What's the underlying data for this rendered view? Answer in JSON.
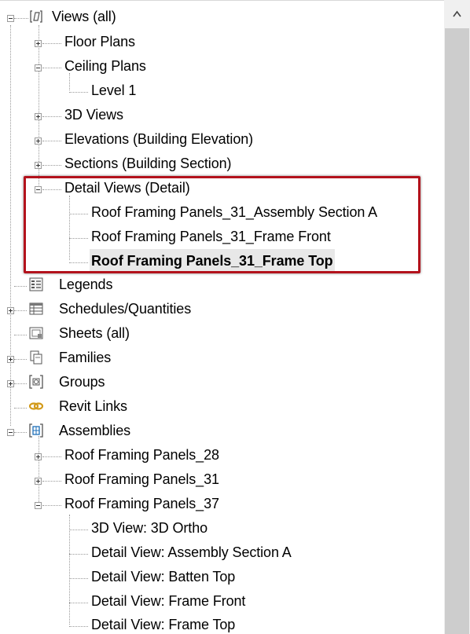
{
  "tree": {
    "views_all": "Views (all)",
    "floor_plans": "Floor Plans",
    "ceiling_plans": "Ceiling Plans",
    "level_1": "Level 1",
    "views_3d": "3D Views",
    "elevations": "Elevations (Building Elevation)",
    "sections": "Sections (Building Section)",
    "detail_views": "Detail Views (Detail)",
    "detail_items": [
      "Roof Framing Panels_31_Assembly Section A",
      "Roof Framing Panels_31_Frame Front",
      "Roof Framing Panels_31_Frame Top"
    ],
    "legends": "Legends",
    "schedules": "Schedules/Quantities",
    "sheets": "Sheets (all)",
    "families": "Families",
    "groups": "Groups",
    "revit_links": "Revit Links",
    "assemblies": "Assemblies",
    "assembly_items": [
      "Roof Framing Panels_28",
      "Roof Framing Panels_31",
      "Roof Framing Panels_37"
    ],
    "assembly_37_children": [
      "3D View: 3D Ortho",
      "Detail View: Assembly Section A",
      "Detail View: Batten Top",
      "Detail View: Frame Front",
      "Detail View: Frame Top"
    ]
  },
  "selected_item": "Roof Framing Panels_31_Frame Top",
  "colors": {
    "highlight_box": "#b3121c",
    "tree_lines": "#9a9a9a",
    "scrollbar_thumb": "#cdcdcd",
    "links_icon": "#d29a1a"
  },
  "icons": {
    "views_root": "views-bracket-icon",
    "legends": "legends-icon",
    "schedules": "schedules-icon",
    "sheets": "sheets-icon",
    "families": "families-icon",
    "groups": "groups-icon",
    "revit_links": "revit-links-icon",
    "assemblies": "assemblies-icon",
    "scroll_up": "chevron-up-icon"
  }
}
